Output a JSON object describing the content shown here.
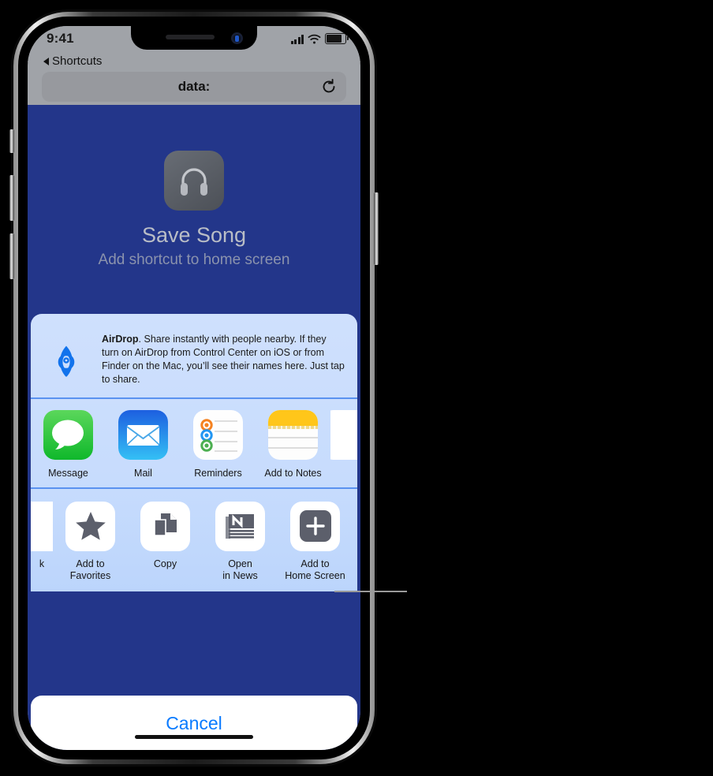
{
  "status_bar": {
    "time": "9:41",
    "signal_icon": "cellular-bars-icon",
    "wifi_icon": "wifi-icon",
    "battery_icon": "battery-icon"
  },
  "browser": {
    "back_label": "Shortcuts",
    "back_icon": "back-triangle-icon",
    "url": "data:",
    "reload_icon": "reload-icon"
  },
  "hero": {
    "app_icon": "headphones-icon",
    "title": "Save Song",
    "subtitle": "Add shortcut to home screen"
  },
  "airdrop": {
    "icon": "airdrop-icon",
    "bold_label": "AirDrop",
    "text": ". Share instantly with people nearby. If they turn on AirDrop from Control Center on iOS or from Finder on the Mac, you’ll see their names here. Just tap to share."
  },
  "apps": [
    {
      "label": "Message",
      "icon": "messages-app-icon"
    },
    {
      "label": "Mail",
      "icon": "mail-app-icon"
    },
    {
      "label": "Reminders",
      "icon": "reminders-app-icon"
    },
    {
      "label": "Add to Notes",
      "icon": "notes-app-icon"
    },
    {
      "label": "",
      "icon": "partial-app-icon"
    }
  ],
  "actions": [
    {
      "label": "k",
      "icon": "bookmark-icon"
    },
    {
      "label": "Add to\nFavorites",
      "icon": "star-icon"
    },
    {
      "label": "Copy",
      "icon": "copy-icon"
    },
    {
      "label": "Open\nin News",
      "icon": "news-icon"
    },
    {
      "label": "Add to\nHome Screen",
      "icon": "plus-icon"
    }
  ],
  "cancel": {
    "label": "Cancel"
  },
  "colors": {
    "sheet_background": "#23368a",
    "panel_background": "#cfe0fd",
    "divider": "#5a92f0",
    "cancel_text": "#0a7bff",
    "screen_background": "#a0a3a8",
    "messages_green": "#34c759",
    "mail_blue": "#1d8fef",
    "notes_yellow": "#ffc800",
    "action_icon_gray": "#5c5f6b"
  }
}
